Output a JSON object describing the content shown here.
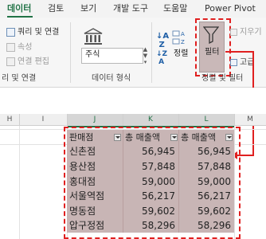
{
  "ribbon": {
    "tabs": [
      {
        "label": "데이터",
        "active": true
      },
      {
        "label": "검토",
        "active": false
      },
      {
        "label": "보기",
        "active": false
      },
      {
        "label": "개발 도구",
        "active": false
      },
      {
        "label": "도움말",
        "active": false
      },
      {
        "label": "Power Pivot",
        "active": false
      }
    ],
    "queries": {
      "refresh_label": "쿼리 및 연결",
      "properties_label": "속성",
      "edit_links_label": "연결 편집",
      "group_label": "리 및 연결"
    },
    "data_types": {
      "stocks_label": "주식",
      "group_label": "데이터 형식"
    },
    "sort_filter": {
      "sort_label": "정렬",
      "filter_label": "필터",
      "clear_label": "지우기",
      "advanced_label": "고급",
      "group_label": "정렬 및 필터"
    }
  },
  "sheet": {
    "columns": [
      {
        "name": "H",
        "selected": false
      },
      {
        "name": "I",
        "selected": false
      },
      {
        "name": "J",
        "selected": true
      },
      {
        "name": "K",
        "selected": true
      },
      {
        "name": "L",
        "selected": true
      },
      {
        "name": "M",
        "selected": false
      }
    ],
    "table": {
      "headers": [
        "판매점",
        "총 매출액",
        "총 매출액"
      ],
      "rows": [
        [
          "신촌점",
          "56,945",
          "56,945"
        ],
        [
          "용산점",
          "57,848",
          "57,848"
        ],
        [
          "홍대점",
          "59,000",
          "59,000"
        ],
        [
          "서울역점",
          "56,217",
          "56,217"
        ],
        [
          "명동점",
          "59,602",
          "59,602"
        ],
        [
          "압구정점",
          "58,296",
          "58,296"
        ]
      ]
    }
  },
  "colors": {
    "accent": "#217346",
    "highlight": "#c8b5b5",
    "annotation": "#e02020"
  }
}
